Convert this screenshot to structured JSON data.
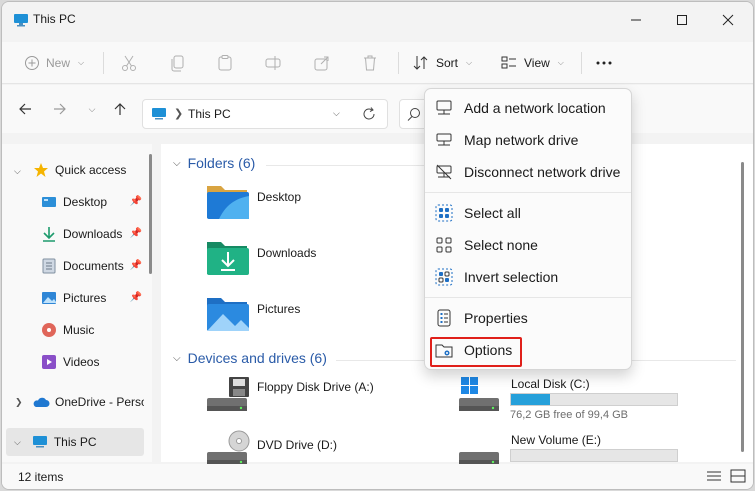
{
  "window": {
    "title": "This PC"
  },
  "commandbar": {
    "new_label": "New",
    "sort_label": "Sort",
    "view_label": "View"
  },
  "address": {
    "crumb": "This PC"
  },
  "sidebar": {
    "items": [
      {
        "label": "Quick access",
        "icon": "star-icon"
      },
      {
        "label": "Desktop",
        "icon": "desktop-icon"
      },
      {
        "label": "Downloads",
        "icon": "download-icon"
      },
      {
        "label": "Documents",
        "icon": "documents-icon"
      },
      {
        "label": "Pictures",
        "icon": "pictures-icon"
      },
      {
        "label": "Music",
        "icon": "music-icon"
      },
      {
        "label": "Videos",
        "icon": "videos-icon"
      },
      {
        "label": "OneDrive - Perso",
        "icon": "cloud-icon"
      },
      {
        "label": "This PC",
        "icon": "monitor-icon"
      }
    ]
  },
  "main": {
    "folders_header": "Folders (6)",
    "folders": [
      {
        "label": "Desktop"
      },
      {
        "label": "Downloads"
      },
      {
        "label": "Pictures"
      }
    ],
    "drives_header": "Devices and drives (6)",
    "drives": [
      {
        "label": "Floppy Disk Drive (A:)"
      },
      {
        "label": "Local Disk (C:)",
        "detail": "76,2 GB free of 99,4 GB",
        "used_fraction": 0.233
      },
      {
        "label": "DVD Drive (D:)"
      },
      {
        "label": "New Volume (E:)",
        "used_fraction": 0.0
      }
    ]
  },
  "menu": {
    "items": [
      {
        "label": "Add a network location",
        "icon": "network-location-icon"
      },
      {
        "label": "Map network drive",
        "icon": "map-drive-icon"
      },
      {
        "label": "Disconnect network drive",
        "icon": "disconnect-drive-icon"
      },
      {
        "label": "Select all",
        "icon": "select-all-icon"
      },
      {
        "label": "Select none",
        "icon": "select-none-icon"
      },
      {
        "label": "Invert selection",
        "icon": "invert-selection-icon"
      },
      {
        "label": "Properties",
        "icon": "properties-icon"
      },
      {
        "label": "Options",
        "icon": "options-icon"
      }
    ],
    "highlight_color": "#e0201a"
  },
  "status": {
    "count": "12 items"
  },
  "colors": {
    "accent": "#26a0da",
    "group_header": "#2a5ba8"
  }
}
